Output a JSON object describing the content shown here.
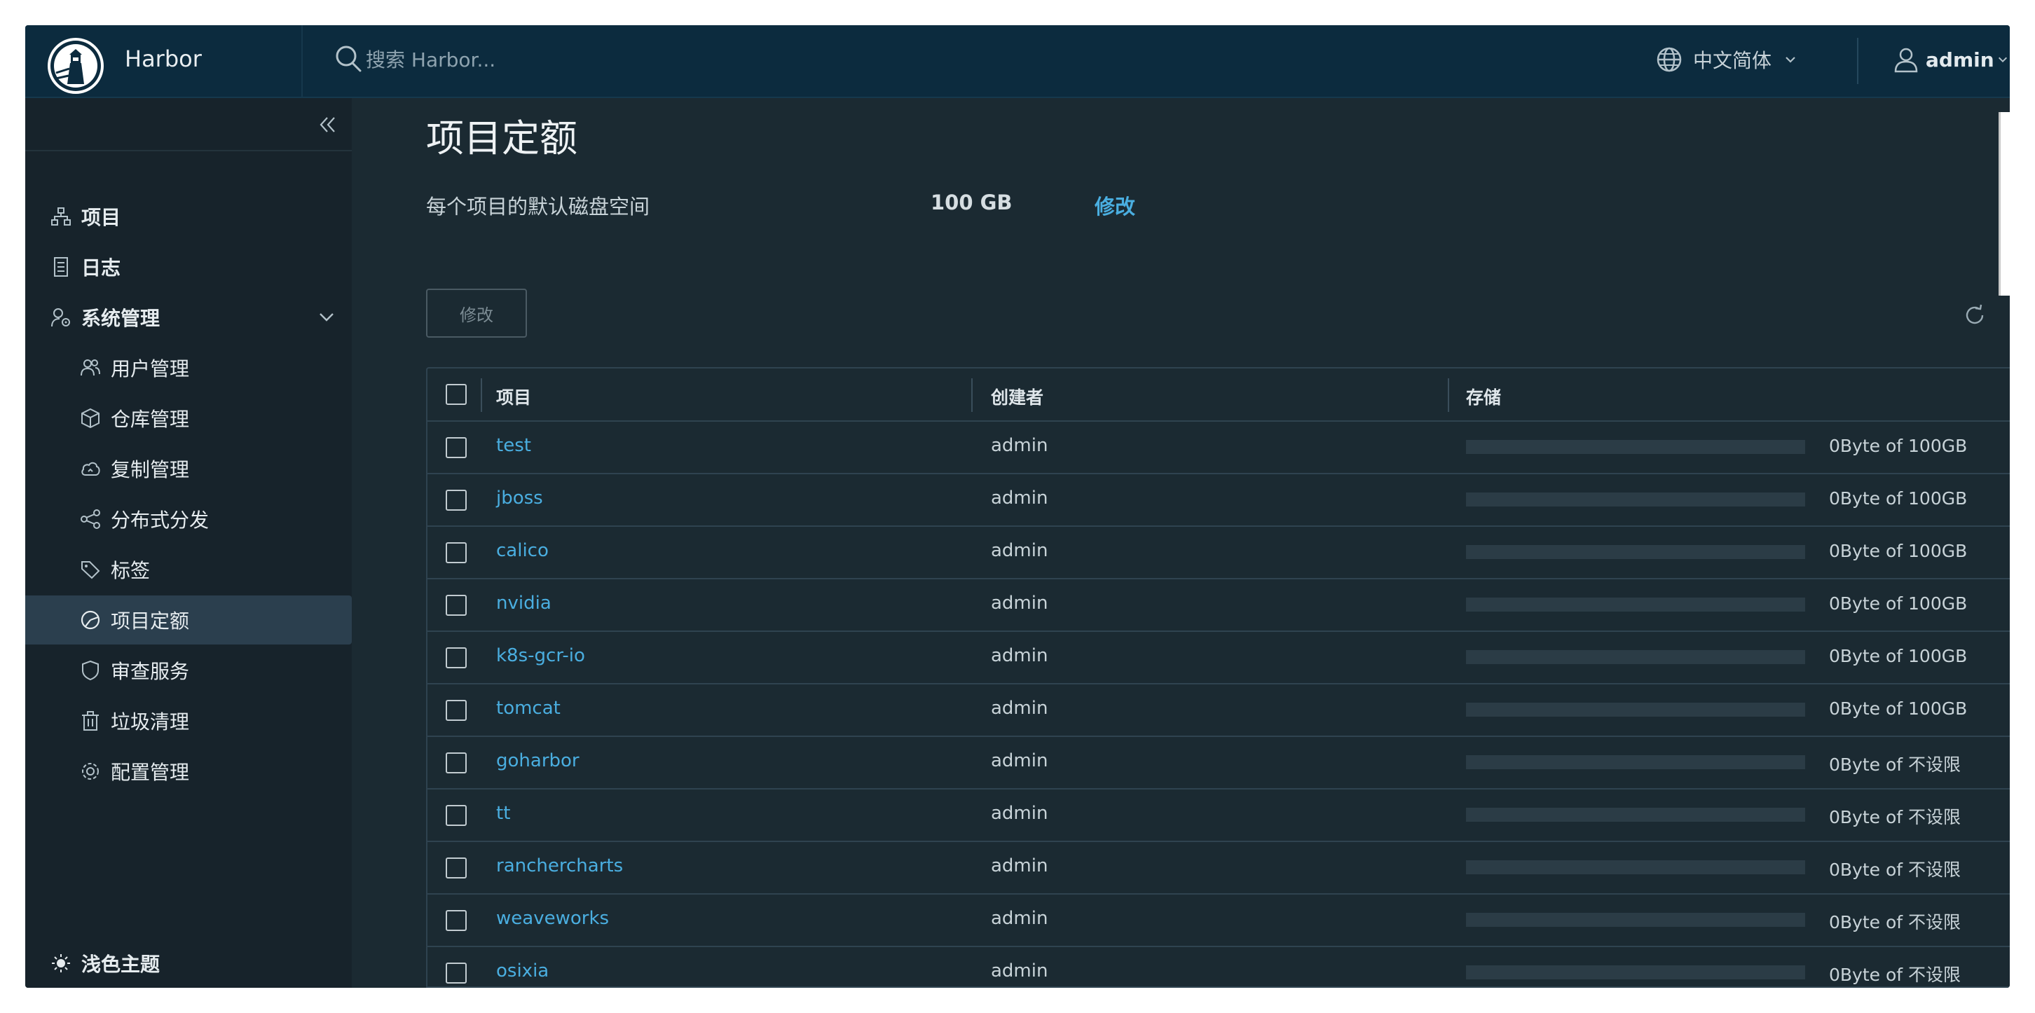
{
  "header": {
    "brand": "Harbor",
    "search_placeholder": "搜索 Harbor...",
    "language": "中文简体",
    "user": "admin"
  },
  "sidebar": {
    "items": [
      {
        "label": "项目",
        "icon": "project-icon"
      },
      {
        "label": "日志",
        "icon": "log-icon"
      },
      {
        "label": "系统管理",
        "icon": "system-admin-icon"
      }
    ],
    "sub_items": [
      {
        "label": "用户管理",
        "icon": "users-icon"
      },
      {
        "label": "仓库管理",
        "icon": "registry-icon"
      },
      {
        "label": "复制管理",
        "icon": "replication-icon"
      },
      {
        "label": "分布式分发",
        "icon": "share-icon"
      },
      {
        "label": "标签",
        "icon": "tag-icon"
      },
      {
        "label": "项目定额",
        "icon": "quota-icon",
        "active": true
      },
      {
        "label": "审查服务",
        "icon": "shield-icon"
      },
      {
        "label": "垃圾清理",
        "icon": "trash-icon"
      },
      {
        "label": "配置管理",
        "icon": "gear-icon"
      }
    ],
    "theme_toggle": "浅色主题"
  },
  "main": {
    "title": "项目定额",
    "default_quota_label": "每个项目的默认磁盘空间",
    "default_quota_value": "100 GB",
    "default_quota_edit": "修改",
    "edit_button": "修改",
    "table": {
      "columns": [
        "项目",
        "创建者",
        "存储"
      ],
      "rows": [
        {
          "project": "test",
          "creator": "admin",
          "storage": "0Byte of 100GB",
          "used_fraction": 0
        },
        {
          "project": "jboss",
          "creator": "admin",
          "storage": "0Byte of 100GB",
          "used_fraction": 0
        },
        {
          "project": "calico",
          "creator": "admin",
          "storage": "0Byte of 100GB",
          "used_fraction": 0
        },
        {
          "project": "nvidia",
          "creator": "admin",
          "storage": "0Byte of 100GB",
          "used_fraction": 0
        },
        {
          "project": "k8s-gcr-io",
          "creator": "admin",
          "storage": "0Byte of 100GB",
          "used_fraction": 0
        },
        {
          "project": "tomcat",
          "creator": "admin",
          "storage": "0Byte of 100GB",
          "used_fraction": 0
        },
        {
          "project": "goharbor",
          "creator": "admin",
          "storage": "0Byte of 不设限",
          "used_fraction": 0
        },
        {
          "project": "tt",
          "creator": "admin",
          "storage": "0Byte of 不设限",
          "used_fraction": 0
        },
        {
          "project": "ranchercharts",
          "creator": "admin",
          "storage": "0Byte of 不设限",
          "used_fraction": 0
        },
        {
          "project": "weaveworks",
          "creator": "admin",
          "storage": "0Byte of 不设限",
          "used_fraction": 0
        },
        {
          "project": "osixia",
          "creator": "admin",
          "storage": "0Byte of 不设限",
          "used_fraction": 0
        }
      ]
    }
  },
  "colors": {
    "header_bg": "#0c2b3e",
    "sidebar_bg": "#17232b",
    "main_bg": "#1b2a32",
    "link": "#4aaee0",
    "active_nav_bg": "#2b3f4e"
  }
}
